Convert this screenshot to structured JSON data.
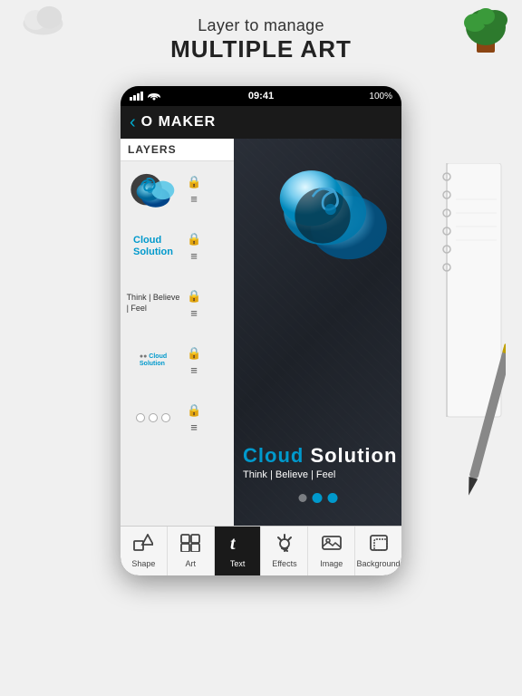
{
  "page": {
    "heading_sub": "Layer to manage",
    "heading_main": "MULTIPLE ART"
  },
  "status_bar": {
    "signal": "●●●●",
    "wifi": "WiFi",
    "time": "09:41",
    "battery": "100%"
  },
  "app_header": {
    "title": "O MAKER",
    "back": "‹"
  },
  "layers_panel": {
    "title": "LAYERS",
    "items": [
      {
        "id": "layer-cloud-logo",
        "type": "logo",
        "label": "Cloud logo"
      },
      {
        "id": "layer-cloud-solution",
        "type": "text",
        "label": "Cloud Solution"
      },
      {
        "id": "layer-think",
        "type": "text",
        "label": "Think | Believe | Feel"
      },
      {
        "id": "layer-combined",
        "type": "text",
        "label": "Cloud Solution combined"
      },
      {
        "id": "layer-dots",
        "type": "shape",
        "label": "Dots"
      }
    ]
  },
  "canvas": {
    "main_text_1": "Cloud",
    "main_text_2": " Solution",
    "sub_text": "Think | Believe | Feel",
    "dots": [
      {
        "active": false
      },
      {
        "active": true
      },
      {
        "active": false
      },
      {
        "active": true
      }
    ]
  },
  "toolbar": {
    "items": [
      {
        "id": "shape",
        "label": "Shape",
        "icon": "shape"
      },
      {
        "id": "art",
        "label": "Art",
        "icon": "art"
      },
      {
        "id": "text",
        "label": "Text",
        "icon": "text",
        "active": true
      },
      {
        "id": "effects",
        "label": "Effects",
        "icon": "effects"
      },
      {
        "id": "image",
        "label": "Image",
        "icon": "image"
      },
      {
        "id": "background",
        "label": "Background",
        "icon": "background"
      }
    ]
  }
}
